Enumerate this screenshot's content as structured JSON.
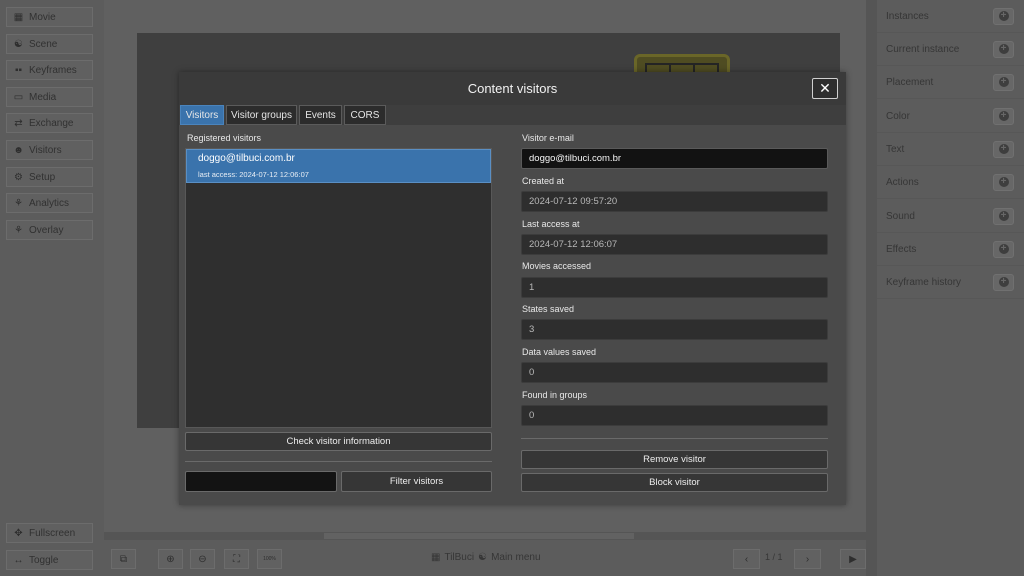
{
  "left_nav": [
    {
      "label": "Movie",
      "icon": "film-icon"
    },
    {
      "label": "Scene",
      "icon": "scene-icon"
    },
    {
      "label": "Keyframes",
      "icon": "grid-icon"
    },
    {
      "label": "Media",
      "icon": "image-icon"
    },
    {
      "label": "Exchange",
      "icon": "exchange-icon"
    },
    {
      "label": "Visitors",
      "icon": "users-icon"
    },
    {
      "label": "Setup",
      "icon": "gear-icon"
    },
    {
      "label": "Analytics",
      "icon": "analytics-icon"
    },
    {
      "label": "Overlay",
      "icon": "overlay-icon"
    }
  ],
  "left_bottom": [
    {
      "label": "Fullscreen",
      "icon": "fullscreen-icon"
    },
    {
      "label": "Toggle",
      "icon": "toggle-icon"
    }
  ],
  "right_panel": [
    "Instances",
    "Current instance",
    "Placement",
    "Color",
    "Text",
    "Actions",
    "Sound",
    "Effects",
    "Keyframe history"
  ],
  "bottom_bar": {
    "brand": "TilBuci",
    "main_menu": "Main menu",
    "zoom_label": "100%",
    "page": "1 / 1"
  },
  "modal": {
    "title": "Content visitors",
    "close": "✕",
    "tabs": [
      "Visitors",
      "Visitor groups",
      "Events",
      "CORS"
    ],
    "active_tab": "Visitors",
    "registered_label": "Registered visitors",
    "visitors": [
      {
        "email": "doggo@tilbuci.com.br",
        "last_access": "last access: 2024-07-12 12:06:07"
      }
    ],
    "check_button": "Check visitor information",
    "filter_value": "",
    "filter_button": "Filter visitors",
    "details": {
      "email_label": "Visitor e-mail",
      "email": "doggo@tilbuci.com.br",
      "created_label": "Created at",
      "created": "2024-07-12 09:57:20",
      "last_access_label": "Last access at",
      "last_access": "2024-07-12 12:06:07",
      "movies_label": "Movies accessed",
      "movies": "1",
      "states_label": "States saved",
      "states": "3",
      "data_label": "Data values saved",
      "data": "0",
      "groups_label": "Found in groups",
      "groups": "0"
    },
    "remove_button": "Remove visitor",
    "block_button": "Block visitor"
  },
  "colors": {
    "accent": "#3a73ac",
    "modal_bg": "#4a4a4a",
    "overlay": "#5a5a5a"
  }
}
